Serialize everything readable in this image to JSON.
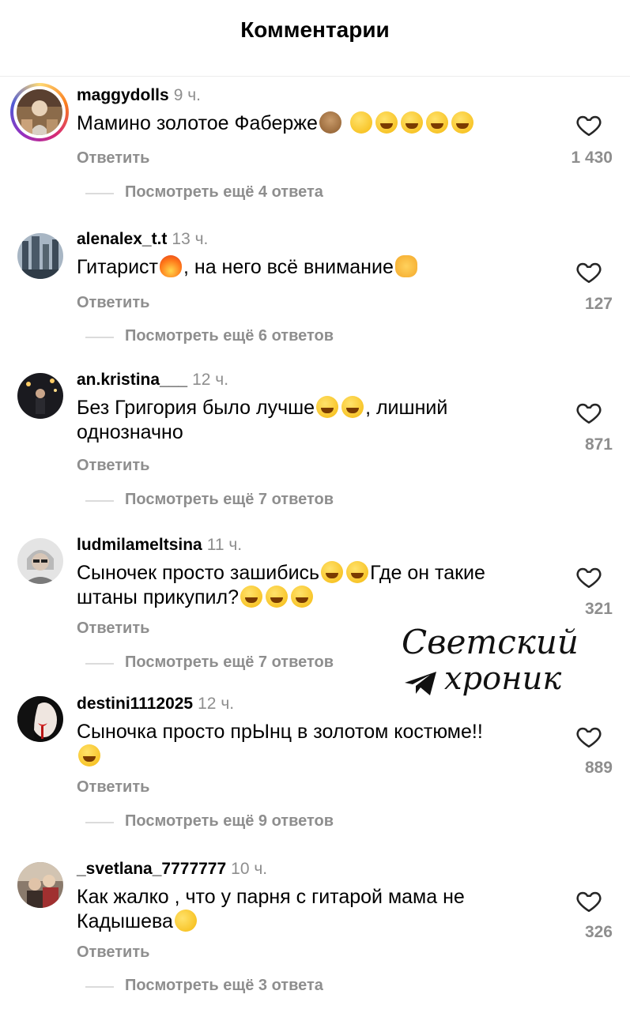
{
  "header": {
    "title": "Комментарии"
  },
  "watermark": {
    "line1": "Светский",
    "line2": "хроник"
  },
  "comments": [
    {
      "username": "maggydolls",
      "time": "9 ч.",
      "text": "Мамино золотое Фаберже",
      "emojis": [
        "see-no-evil-monkey-emoji",
        "shushing-face-emoji",
        "tears-of-joy-emoji",
        "tears-of-joy-emoji",
        "tears-of-joy-emoji",
        "tears-of-joy-emoji"
      ],
      "reply_label": "Ответить",
      "view_replies": "Посмотреть ещё 4 ответа",
      "likes": "1 430",
      "has_story_ring": true
    },
    {
      "username": "alenalex_t.t",
      "time": "13 ч.",
      "text_part1": "Гитарист",
      "text_part2": ", на него всё внимание",
      "reply_label": "Ответить",
      "view_replies": "Посмотреть ещё 6 ответов",
      "likes": "127"
    },
    {
      "username": "an.kristina___",
      "time": "12 ч.",
      "text_part1": "Без Григория было лучше",
      "text_part2": ", лишний однозначно",
      "reply_label": "Ответить",
      "view_replies": "Посмотреть ещё 7 ответов",
      "likes": "871"
    },
    {
      "username": "ludmilameltsina",
      "time": "11 ч.",
      "text_part1": "Сыночек просто зашибись",
      "text_part2": "Где он такие штаны прикупил?",
      "reply_label": "Ответить",
      "view_replies": "Посмотреть ещё 7 ответов",
      "likes": "321"
    },
    {
      "username": "destini1112025",
      "time": "12 ч.",
      "text": "Сыночка просто прЫнц в золотом костюме!!",
      "reply_label": "Ответить",
      "view_replies": "Посмотреть ещё 9 ответов",
      "likes": "889"
    },
    {
      "username": "_svetlana_7777777",
      "time": "10 ч.",
      "text_part1": "Как жалко , что у парня с гитарой мама не Кадышева",
      "reply_label": "Ответить",
      "view_replies": "Посмотреть ещё 3 ответа",
      "likes": "326"
    }
  ],
  "colors": {
    "muted": "#8e8e8e",
    "divider": "#dbdbdb",
    "text": "#000000"
  }
}
